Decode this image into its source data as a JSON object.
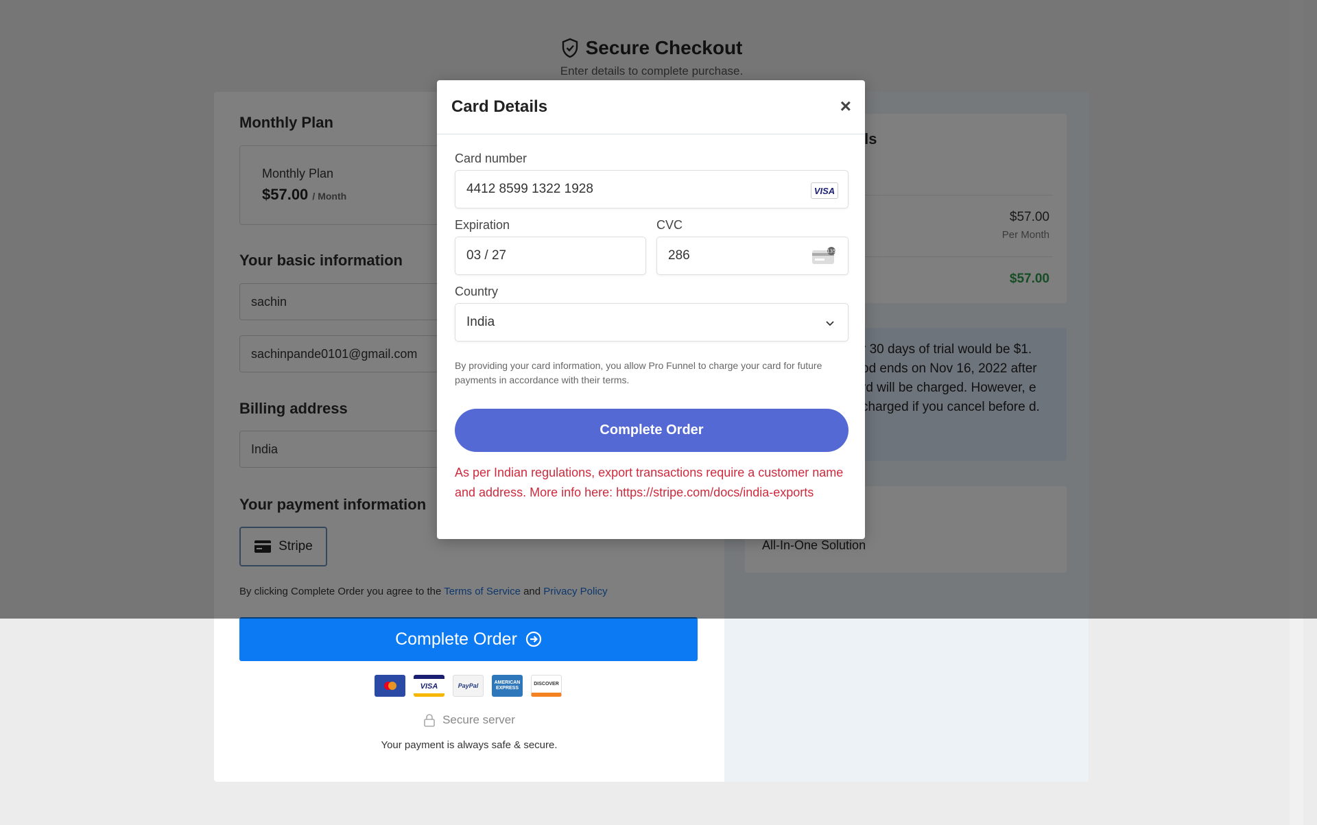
{
  "header": {
    "title": "Secure Checkout",
    "subtitle": "Enter details to complete purchase."
  },
  "plan": {
    "section_title": "Monthly Plan",
    "name": "Monthly Plan",
    "price": "$57.00",
    "period": "/ Month"
  },
  "basic_info": {
    "section_title": "Your basic information",
    "name_value": "sachin",
    "email_value": "sachinpande0101@gmail.com"
  },
  "billing": {
    "section_title": "Billing address",
    "country_value": "India"
  },
  "payment": {
    "section_title": "Your payment information",
    "method_label": "Stripe"
  },
  "terms": {
    "prefix": "By clicking Complete Order you agree to the ",
    "tos": "Terms of Service",
    "and": " and ",
    "privacy": "Privacy Policy"
  },
  "complete_order_label": "Complete Order",
  "payment_icons": [
    "mastercard-icon",
    "visa-icon",
    "paypal-icon",
    "amex-icon",
    "discover-icon"
  ],
  "secure_server": "Secure server",
  "secure_note": "Your payment is always safe & secure.",
  "order_details": {
    "title_fragment": "ils",
    "price": "$57.00",
    "per": "Per Month",
    "total": "$57.00"
  },
  "trial_text_fragment": "r 30 days of trial would be $1. od ends on Nov 16, 2022 after rd will be charged. However, e charged if you cancel before d.",
  "feature": "All-In-One Solution",
  "modal": {
    "title": "Card Details",
    "close": "×",
    "card_number_label": "Card number",
    "card_number_value": "4412 8599 1322 1928",
    "card_brand": "VISA",
    "expiration_label": "Expiration",
    "expiration_value": "03 / 27",
    "cvc_label": "CVC",
    "cvc_value": "286",
    "country_label": "Country",
    "country_value": "India",
    "disclaimer": "By providing your card information, you allow Pro Funnel to charge your card for future payments in accordance with their terms.",
    "button_label": "Complete Order",
    "error": "As per Indian regulations, export transactions require a customer name and address. More info here: https://stripe.com/docs/india-exports"
  },
  "colors": {
    "primary_button": "#0b7af3",
    "modal_button": "#5469d4",
    "error": "#cd2a3d",
    "total_green": "#2e9b4b"
  }
}
